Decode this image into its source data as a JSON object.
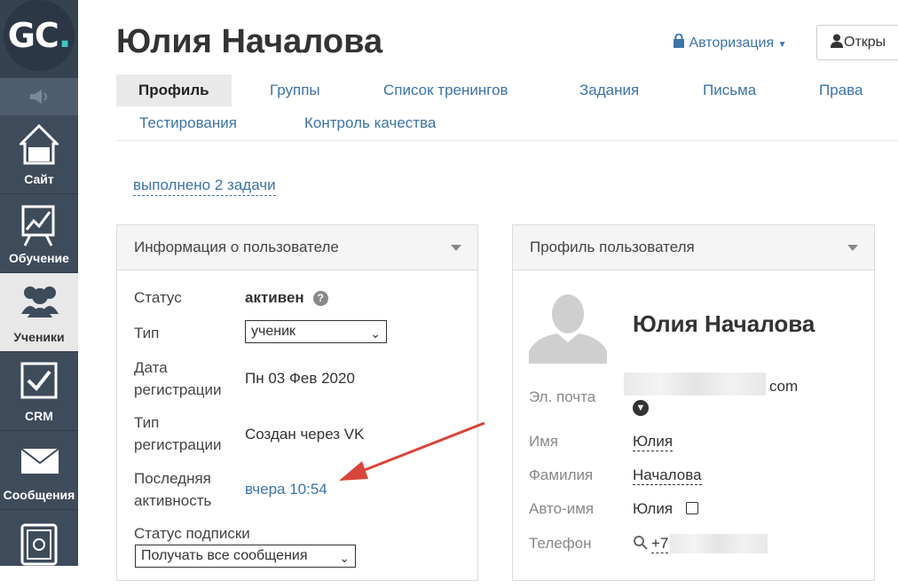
{
  "sidebar": {
    "logo": {
      "text": "GC",
      "dot": "."
    },
    "items": [
      {
        "label": "Сайт",
        "icon": "home-icon"
      },
      {
        "label": "Обучение",
        "icon": "chart-board-icon"
      },
      {
        "label": "Ученики",
        "icon": "users-icon"
      },
      {
        "label": "CRM",
        "icon": "checkbox-icon"
      },
      {
        "label": "Сообщения",
        "icon": "envelope-icon"
      }
    ]
  },
  "header": {
    "title": "Юлия Началова",
    "auth_label": "Авторизация",
    "open_button": "Откры"
  },
  "tabs": {
    "profile": "Профиль",
    "groups": "Группы",
    "trainings": "Список тренингов",
    "tasks": "Задания",
    "letters": "Письма",
    "rights": "Права",
    "testing": "Тестирования",
    "quality": "Контроль качества"
  },
  "done_tasks_link": "выполнено 2 задачи",
  "user_info": {
    "title": "Информация о пользователе",
    "status_label": "Статус",
    "status_value": "активен",
    "type_label": "Тип",
    "type_value": "ученик",
    "reg_date_label_1": "Дата",
    "reg_date_label_2": "регистрации",
    "reg_date_value": "Пн 03 Фев 2020",
    "reg_type_label_1": "Тип",
    "reg_type_label_2": "регистрации",
    "reg_type_value": "Создан через VK",
    "last_activity_label_1": "Последняя",
    "last_activity_label_2": "активность",
    "last_activity_value": "вчера 10:54",
    "subscription_label": "Статус подписки",
    "subscription_value": "Получать все сообщения"
  },
  "user_profile": {
    "title": "Профиль пользователя",
    "name": "Юлия Началова",
    "email_label": "Эл. почта",
    "email_suffix": "com",
    "first_name_label": "Имя",
    "first_name_value": "Юлия",
    "last_name_label": "Фамилия",
    "last_name_value": "Началова",
    "auto_name_label": "Авто-имя",
    "auto_name_value": "Юлия",
    "phone_label": "Телефон",
    "phone_prefix": "+7"
  },
  "colors": {
    "accent": "#3b74a8",
    "arrow": "#d9453a",
    "sidebar": "#3d4b5b"
  }
}
